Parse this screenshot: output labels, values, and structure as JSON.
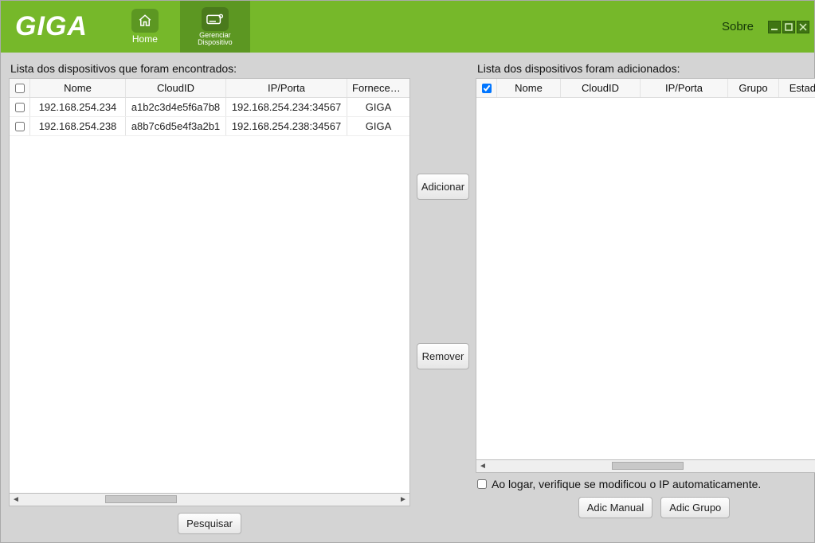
{
  "brand": "GIGA",
  "header": {
    "nav": {
      "home": "Home",
      "manage_line1": "Gerenciar",
      "manage_line2": "Dispositivo"
    },
    "about": "Sobre"
  },
  "left": {
    "title": "Lista dos dispositivos que foram encontrados:",
    "columns": {
      "nome": "Nome",
      "cloudid": "CloudID",
      "ipporta": "IP/Porta",
      "fornecedor": "Fornecedor"
    },
    "rows": [
      {
        "nome": "192.168.254.234",
        "cloudid": "a1b2c3d4e5f6a7b8",
        "ipporta": "192.168.254.234:34567",
        "fornecedor": "GIGA"
      },
      {
        "nome": "192.168.254.238",
        "cloudid": "a8b7c6d5e4f3a2b1",
        "ipporta": "192.168.254.238:34567",
        "fornecedor": "GIGA"
      }
    ],
    "search_btn": "Pesquisar"
  },
  "mid": {
    "add": "Adicionar",
    "remove": "Remover"
  },
  "right": {
    "title": "Lista dos dispositivos foram adicionados:",
    "columns": {
      "nome": "Nome",
      "cloudid": "CloudID",
      "ipporta": "IP/Porta",
      "grupo": "Grupo",
      "estado": "Estado"
    },
    "auto_ip_label": "Ao logar, verifique se  modificou o IP automaticamente.",
    "adic_manual": "Adic Manual",
    "adic_grupo": "Adic Grupo"
  }
}
